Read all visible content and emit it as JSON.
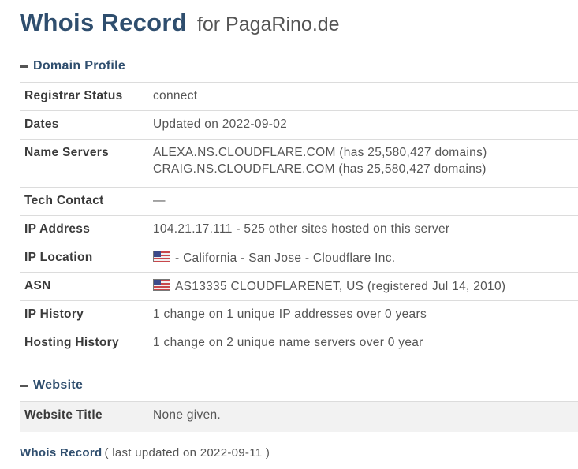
{
  "title": {
    "main": "Whois Record",
    "sub": "for PagaRino.de"
  },
  "domain_profile": {
    "heading": "Domain Profile",
    "rows": [
      {
        "label": "Registrar Status",
        "value": "connect"
      },
      {
        "label": "Dates",
        "value": "Updated on 2022-09-02"
      },
      {
        "label": "Name Servers",
        "value": "ALEXA.NS.CLOUDFLARE.COM (has 25,580,427 domains)",
        "value2": "CRAIG.NS.CLOUDFLARE.COM (has 25,580,427 domains)"
      },
      {
        "label": "Tech Contact",
        "value": "—"
      },
      {
        "label": "IP Address",
        "value": "104.21.17.111 - 525 other sites hosted on this server"
      },
      {
        "label": "IP Location",
        "value": "- California - San Jose - Cloudflare Inc.",
        "icon": "us-flag-icon"
      },
      {
        "label": "ASN",
        "value": "AS13335 CLOUDFLARENET, US (registered Jul 14, 2010)",
        "icon": "us-flag-icon"
      },
      {
        "label": "IP History",
        "value": "1 change on 1 unique IP addresses over 0 years"
      },
      {
        "label": "Hosting History",
        "value": "1 change on 2 unique name servers over 0 year"
      }
    ]
  },
  "website": {
    "heading": "Website",
    "rows": [
      {
        "label": "Website Title",
        "value": "None given."
      }
    ]
  },
  "footer": {
    "link": "Whois Record",
    "note": "( last updated on 2022-09-11 )"
  },
  "colors": {
    "heading": "#2f4e6e",
    "text": "#555555",
    "border": "#dcdcdc"
  }
}
